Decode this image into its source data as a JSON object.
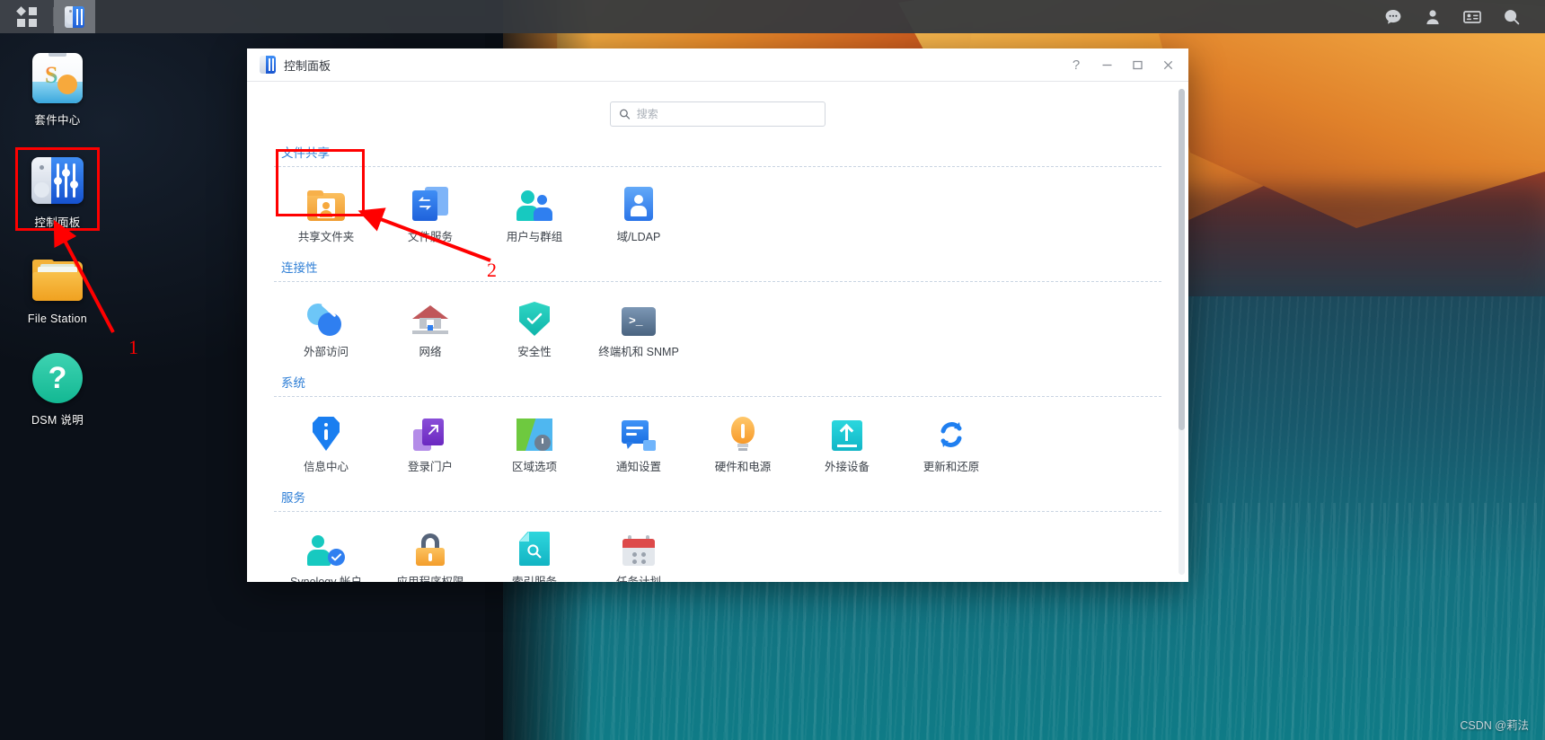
{
  "taskbar": {
    "main_menu_label": "main-menu",
    "app_button_label": "控制面板",
    "right_icons": [
      {
        "name": "chat-icon",
        "label": "聊天"
      },
      {
        "name": "user-icon",
        "label": "个人"
      },
      {
        "name": "notifications-icon",
        "label": "通知"
      },
      {
        "name": "search-icon",
        "label": "搜索"
      }
    ]
  },
  "desktop": {
    "icons": [
      {
        "label": "套件中心",
        "icon": "package-center-icon"
      },
      {
        "label": "控制面板",
        "icon": "control-panel-icon"
      },
      {
        "label": "File Station",
        "icon": "file-station-icon"
      },
      {
        "label": "DSM 说明",
        "icon": "dsm-help-icon"
      }
    ]
  },
  "annotations": {
    "step1": "1",
    "step2": "2"
  },
  "window": {
    "title": "控制面板",
    "controls": {
      "help": "?",
      "minimize": "—",
      "maximize": "▢",
      "close": "✕"
    }
  },
  "search": {
    "placeholder": "搜索",
    "value": ""
  },
  "sections": [
    {
      "title": "文件共享",
      "items": [
        {
          "label": "共享文件夹",
          "icon": "shared-folder-icon",
          "highlighted": true
        },
        {
          "label": "文件服务",
          "icon": "file-service-icon"
        },
        {
          "label": "用户与群组",
          "icon": "users-groups-icon"
        },
        {
          "label": "域/LDAP",
          "icon": "domain-ldap-icon"
        }
      ]
    },
    {
      "title": "连接性",
      "items": [
        {
          "label": "外部访问",
          "icon": "external-access-icon"
        },
        {
          "label": "网络",
          "icon": "network-icon"
        },
        {
          "label": "安全性",
          "icon": "security-shield-icon"
        },
        {
          "label": "终端机和 SNMP",
          "icon": "terminal-snmp-icon"
        }
      ]
    },
    {
      "title": "系统",
      "items": [
        {
          "label": "信息中心",
          "icon": "info-center-icon"
        },
        {
          "label": "登录门户",
          "icon": "login-portal-icon"
        },
        {
          "label": "区域选项",
          "icon": "regional-options-icon"
        },
        {
          "label": "通知设置",
          "icon": "notification-icon"
        },
        {
          "label": "硬件和电源",
          "icon": "hardware-power-icon"
        },
        {
          "label": "外接设备",
          "icon": "external-devices-icon"
        },
        {
          "label": "更新和还原",
          "icon": "update-restore-icon"
        }
      ]
    },
    {
      "title": "服务",
      "items": [
        {
          "label": "Synology 帐户",
          "icon": "synology-account-icon"
        },
        {
          "label": "应用程序权限",
          "icon": "app-privileges-icon"
        },
        {
          "label": "索引服务",
          "icon": "index-service-icon"
        },
        {
          "label": "任务计划",
          "icon": "task-scheduler-icon"
        }
      ]
    }
  ],
  "watermark": "CSDN @莉法",
  "colors": {
    "accent": "#2f7fd6",
    "annotation": "#ff0000",
    "window_bg": "#ffffff"
  }
}
